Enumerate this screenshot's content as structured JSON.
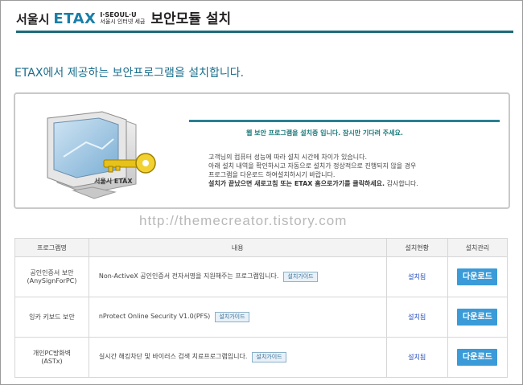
{
  "header": {
    "city": "서울시",
    "etax": "ETAX",
    "small_top": "I·SEOUL·U",
    "small_bottom": "서울시 인터넷 세금",
    "title": "보안모듈 설치"
  },
  "headline": "ETAX에서 제공하는 보안프로그램을 설치합니다.",
  "install_box": {
    "monitor_label": "서울시 ETAX",
    "status": "웹 보안 프로그램을 설치중 입니다. 잠시만 기다려 주세요.",
    "lines": [
      "고객님의 컴퓨터 성능에 따라 설치 시간에 차이가 있습니다.",
      "아래 설치 내역을 확인하시고 자동으로 설치가 정상적으로 진행되지 않을 경우",
      "프로그램을 다운로드 하여설치하시기 바랍니다."
    ],
    "bold_line": "설치가 끝났으면 새로고침 또는 ETAX 홈으로가기를 클릭하세요.",
    "tail": "감사합니다."
  },
  "watermark": "http://themecreator.tistory.com",
  "table": {
    "headers": [
      "프로그램명",
      "내용",
      "설치현황",
      "설치관리"
    ],
    "rows": [
      {
        "name": "공인인증서 보안\n(AnySignForPC)",
        "desc": "Non-ActiveX 공인인증서 전자서명을 지원해주는 프로그램입니다.",
        "guide": "설치가이드",
        "status": "설치됨",
        "action": "다운로드"
      },
      {
        "name": "잉카 키보드 보안",
        "desc": "nProtect Online Security V1.0(PFS)",
        "guide": "설치가이드",
        "status": "설치됨",
        "action": "다운로드"
      },
      {
        "name": "개인PC방화벽\n(ASTx)",
        "desc": "실시간 해킹차단 및 바이러스 검색 치료프로그램입니다.",
        "guide": "설치가이드",
        "status": "설치됨",
        "action": "다운로드"
      }
    ]
  },
  "colors": {
    "accent": "#1c6b7a",
    "link": "#1a46b8",
    "button": "#3a9bd8"
  },
  "icons": {
    "monitor": "computer-monitor-icon",
    "key": "key-icon"
  }
}
